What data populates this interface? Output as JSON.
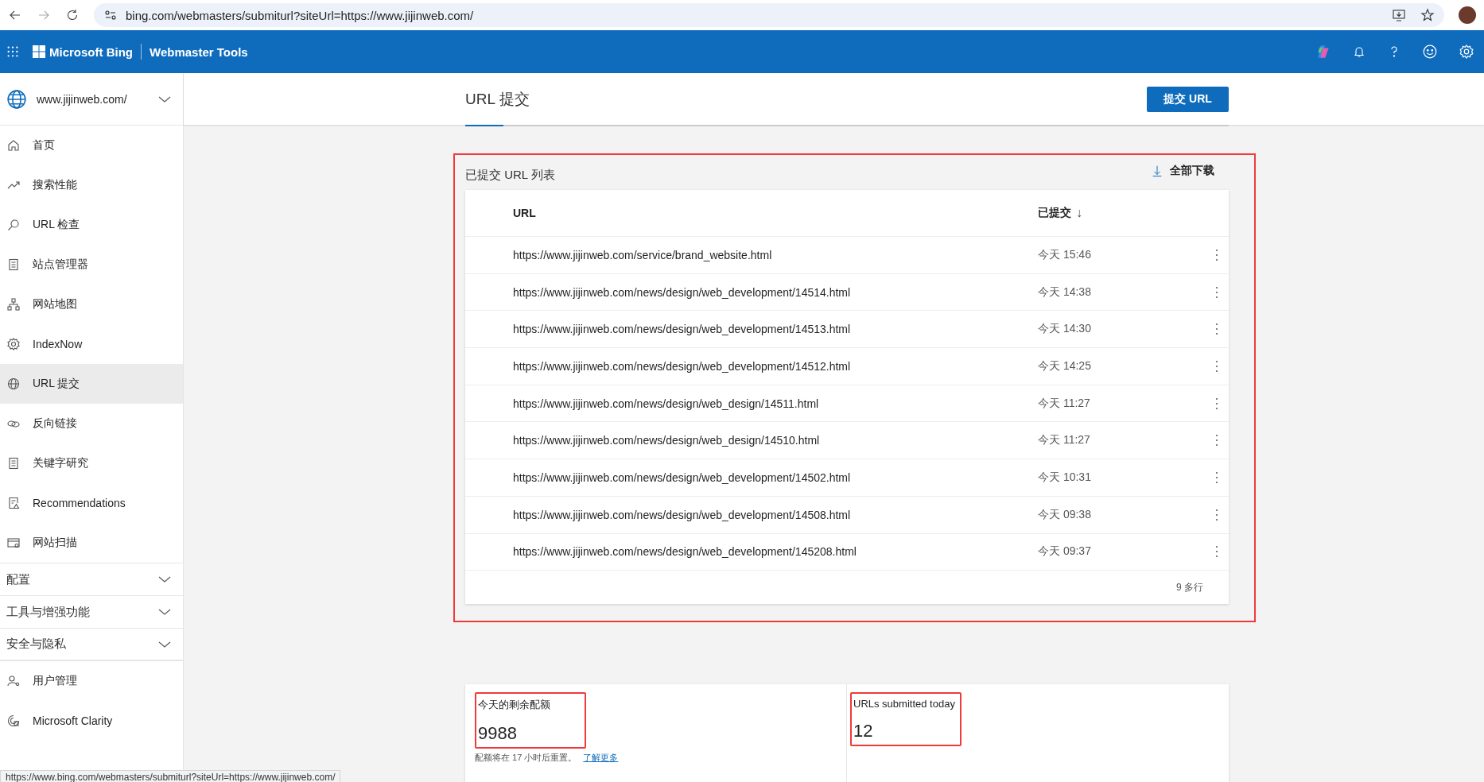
{
  "browser": {
    "address": "bing.com/webmasters/submiturl?siteUrl=https://www.jijinweb.com/"
  },
  "header": {
    "brand": "Microsoft Bing",
    "product": "Webmaster Tools"
  },
  "sidebar": {
    "site": "www.jijinweb.com/",
    "items": [
      {
        "label": "首页",
        "selected": false
      },
      {
        "label": "搜索性能",
        "selected": false
      },
      {
        "label": "URL 检查",
        "selected": false
      },
      {
        "label": "站点管理器",
        "selected": false
      },
      {
        "label": "网站地图",
        "selected": false
      },
      {
        "label": "IndexNow",
        "selected": false
      },
      {
        "label": "URL 提交",
        "selected": true
      },
      {
        "label": "反向链接",
        "selected": false
      },
      {
        "label": "关键字研究",
        "selected": false
      },
      {
        "label": "Recommendations",
        "selected": false
      },
      {
        "label": "网站扫描",
        "selected": false
      }
    ],
    "sections": [
      {
        "label": "配置",
        "expanded": false
      },
      {
        "label": "工具与增强功能",
        "expanded": false
      },
      {
        "label": "安全与隐私",
        "expanded": false
      }
    ],
    "bottom_items": [
      {
        "label": "用户管理",
        "selected": false
      },
      {
        "label": "Microsoft Clarity",
        "selected": false
      }
    ]
  },
  "page": {
    "title": "URL 提交",
    "submit_button": "提交 URL"
  },
  "list": {
    "title": "已提交 URL 列表",
    "download": "全部下载",
    "columns": [
      "URL",
      "已提交"
    ],
    "sort_mark": "↓",
    "rows": [
      {
        "url": "https://www.jijinweb.com/service/brand_website.html",
        "submitted": "今天 15:46"
      },
      {
        "url": "https://www.jijinweb.com/news/design/web_development/14514.html",
        "submitted": "今天 14:38"
      },
      {
        "url": "https://www.jijinweb.com/news/design/web_development/14513.html",
        "submitted": "今天 14:30"
      },
      {
        "url": "https://www.jijinweb.com/news/design/web_development/14512.html",
        "submitted": "今天 14:25"
      },
      {
        "url": "https://www.jijinweb.com/news/design/web_design/14511.html",
        "submitted": "今天 11:27"
      },
      {
        "url": "https://www.jijinweb.com/news/design/web_design/14510.html",
        "submitted": "今天 11:27"
      },
      {
        "url": "https://www.jijinweb.com/news/design/web_development/14502.html",
        "submitted": "今天 10:31"
      },
      {
        "url": "https://www.jijinweb.com/news/design/web_development/14508.html",
        "submitted": "今天 09:38"
      },
      {
        "url": "https://www.jijinweb.com/news/design/web_development/145208.html",
        "submitted": "今天 09:37"
      }
    ],
    "footer": "9 多行"
  },
  "stats": [
    {
      "label": "今天的剩余配额",
      "value": "9988",
      "note": "配额将在 17 小时后重置。",
      "link": "了解更多"
    },
    {
      "label": "URLs submitted today",
      "value": "12"
    }
  ],
  "status_bar": "https://www.bing.com/webmasters/submiturl?siteUrl=https://www.jijinweb.com/"
}
